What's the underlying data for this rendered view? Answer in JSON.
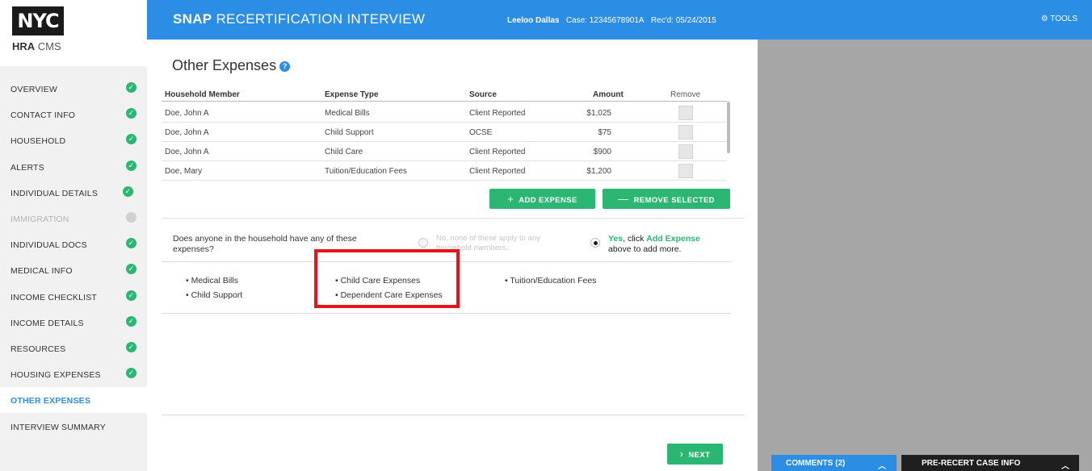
{
  "brand": {
    "logo": "NYC",
    "sub_bold": "HRA",
    "sub_rest": " CMS"
  },
  "header": {
    "title_bold": "SNAP",
    "title_rest": " RECERTIFICATION INTERVIEW",
    "client_name": "Leeloo Dallas",
    "case": "Case: 12345678901A",
    "received": "Rec'd: 05/24/2015",
    "tools": "TOOLS",
    "color": "#2b8de3"
  },
  "sidebar": {
    "items": [
      {
        "label": "OVERVIEW",
        "state": "done"
      },
      {
        "label": "CONTACT INFO",
        "state": "done"
      },
      {
        "label": "HOUSEHOLD",
        "state": "done"
      },
      {
        "label": "ALERTS",
        "state": "done"
      },
      {
        "label": "INDIVIDUAL DETAILS",
        "state": "done"
      },
      {
        "label": "IMMIGRATION",
        "state": "disabled"
      },
      {
        "label": "INDIVIDUAL DOCS",
        "state": "done"
      },
      {
        "label": "MEDICAL INFO",
        "state": "done"
      },
      {
        "label": "INCOME CHECKLIST",
        "state": "done"
      },
      {
        "label": "INCOME DETAILS",
        "state": "done"
      },
      {
        "label": "RESOURCES",
        "state": "done"
      },
      {
        "label": "HOUSING EXPENSES",
        "state": "done"
      },
      {
        "label": "OTHER EXPENSES",
        "state": "active"
      },
      {
        "label": "INTERVIEW SUMMARY",
        "state": "pending"
      }
    ]
  },
  "main": {
    "title": "Other Expenses",
    "help_icon": "?",
    "table": {
      "headers": [
        "Household Member",
        "Expense Type",
        "Source",
        "Amount",
        "Remove"
      ],
      "rows": [
        [
          "Doe, John A",
          "Medical Bills",
          "Client Reported",
          "$1,025"
        ],
        [
          "Doe, John A",
          "Child Support",
          "OCSE",
          "$75"
        ],
        [
          "Doe, John A",
          "Child Care",
          "Client Reported",
          "$900"
        ],
        [
          "Doe, Mary",
          "Tuition/Education Fees",
          "Client Reported",
          "$1,200"
        ]
      ]
    },
    "add_expense_label": "ADD EXPENSE",
    "remove_selected_label": "REMOVE SELECTED",
    "question": "Does anyone in the household have any of these expenses?",
    "option_no": "No, none of these apply to any household members.",
    "option_yes_prefix": "Yes",
    "option_yes_mid": ", click ",
    "option_yes_link": "Add Expense",
    "option_yes_suffix": " above to add more.",
    "expense_list": [
      "• Medical Bills",
      "• Child Support",
      "• Child Care Expenses",
      "• Dependent Care Expenses",
      "• Tuition/Education Fees"
    ],
    "next_label": "NEXT",
    "accent_green": "#2bb673",
    "highlight_color": "#e3141b"
  },
  "footer": {
    "comments_label": "COMMENTS (2)",
    "precase_label": "PRE-RECERT CASE INFO"
  }
}
